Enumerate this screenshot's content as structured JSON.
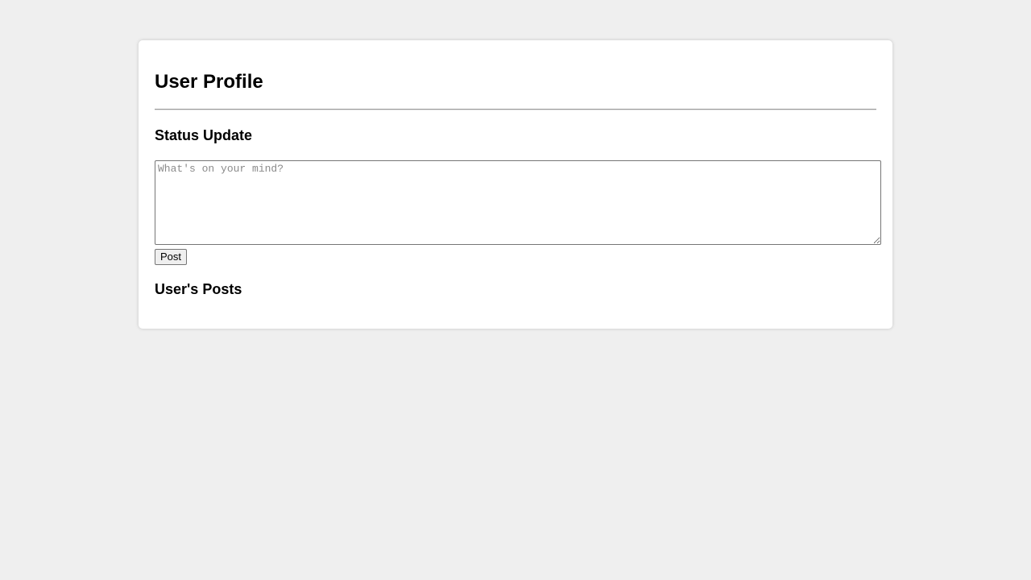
{
  "profile": {
    "title": "User Profile"
  },
  "status_update": {
    "heading": "Status Update",
    "placeholder": "What's on your mind?",
    "value": "",
    "post_label": "Post"
  },
  "posts": {
    "heading": "User's Posts",
    "items": []
  },
  "colors": {
    "background": "#efefef",
    "card": "#ffffff"
  }
}
